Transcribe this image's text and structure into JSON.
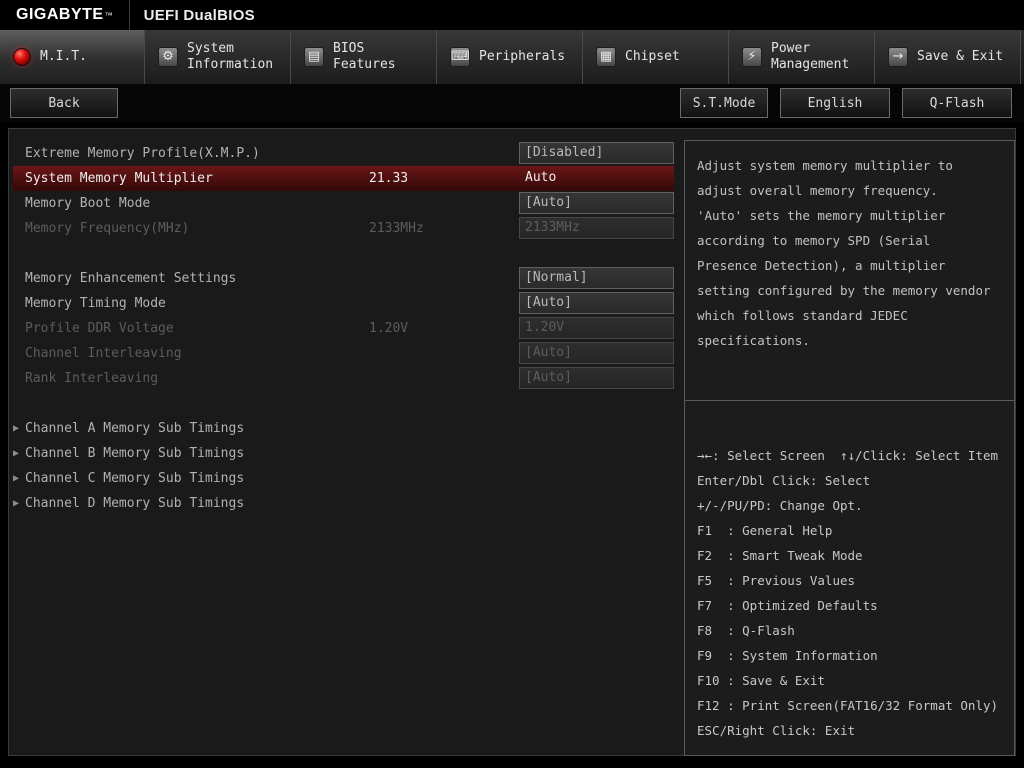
{
  "header": {
    "brand": "GIGABYTE",
    "trademark": "™",
    "title": "UEFI DualBIOS"
  },
  "colors": {
    "selected_row": "#6b1616",
    "brand_orb_red": "#e01212"
  },
  "tabs": [
    {
      "id": "mit",
      "label": "M.I.T.",
      "icon": "mit-orb-icon",
      "glyph": "",
      "active": true
    },
    {
      "id": "system-information",
      "label": "System Information",
      "icon": "gear-icon",
      "glyph": "⚙",
      "active": false
    },
    {
      "id": "bios-features",
      "label": "BIOS Features",
      "icon": "bios-icon",
      "glyph": "▤",
      "active": false
    },
    {
      "id": "peripherals",
      "label": "Peripherals",
      "icon": "peripherals-icon",
      "glyph": "⌨",
      "active": false
    },
    {
      "id": "chipset",
      "label": "Chipset",
      "icon": "chipset-icon",
      "glyph": "▦",
      "active": false
    },
    {
      "id": "power-management",
      "label": "Power Management",
      "icon": "power-icon",
      "glyph": "⚡",
      "active": false
    },
    {
      "id": "save-exit",
      "label": "Save & Exit",
      "icon": "save-exit-icon",
      "glyph": "→",
      "active": false
    }
  ],
  "toolbar": {
    "back": "Back",
    "st_mode": "S.T.Mode",
    "language": "English",
    "q_flash": "Q-Flash"
  },
  "settings": {
    "rows": [
      {
        "type": "option",
        "label": "Extreme Memory Profile(X.M.P.)",
        "current": "",
        "value": "[Disabled]",
        "state": "normal"
      },
      {
        "type": "option",
        "label": "System Memory Multiplier",
        "current": "21.33",
        "value": "Auto",
        "state": "selected"
      },
      {
        "type": "option",
        "label": "Memory Boot Mode",
        "current": "",
        "value": "[Auto]",
        "state": "normal"
      },
      {
        "type": "option",
        "label": "Memory Frequency(MHz)",
        "current": "2133MHz",
        "value": "2133MHz",
        "state": "disabled"
      },
      {
        "type": "spacer"
      },
      {
        "type": "option",
        "label": "Memory Enhancement Settings",
        "current": "",
        "value": "[Normal]",
        "state": "normal"
      },
      {
        "type": "option",
        "label": "Memory Timing Mode",
        "current": "",
        "value": "[Auto]",
        "state": "normal"
      },
      {
        "type": "option",
        "label": "Profile DDR Voltage",
        "current": "1.20V",
        "value": "1.20V",
        "state": "disabled"
      },
      {
        "type": "option",
        "label": "Channel Interleaving",
        "current": "",
        "value": "[Auto]",
        "state": "disabled"
      },
      {
        "type": "option",
        "label": "Rank Interleaving",
        "current": "",
        "value": "[Auto]",
        "state": "disabled"
      },
      {
        "type": "spacer"
      },
      {
        "type": "submenu",
        "label": "Channel A Memory Sub Timings"
      },
      {
        "type": "submenu",
        "label": "Channel B Memory Sub Timings"
      },
      {
        "type": "submenu",
        "label": "Channel C Memory Sub Timings"
      },
      {
        "type": "submenu",
        "label": "Channel D Memory Sub Timings"
      }
    ],
    "submenu_arrow": "▶"
  },
  "help": {
    "text": "Adjust system memory multiplier to\nadjust overall memory frequency.\n'Auto' sets the memory multiplier\naccording to memory SPD (Serial\nPresence Detection), a multiplier\nsetting configured by the memory vendor\nwhich follows standard JEDEC\nspecifications."
  },
  "shortcuts": [
    "→←: Select Screen  ↑↓/Click: Select Item",
    "Enter/Dbl Click: Select",
    "+/-/PU/PD: Change Opt.",
    "F1  : General Help",
    "F2  : Smart Tweak Mode",
    "F5  : Previous Values",
    "F7  : Optimized Defaults",
    "F8  : Q-Flash",
    "F9  : System Information",
    "F10 : Save & Exit",
    "F12 : Print Screen(FAT16/32 Format Only)",
    "ESC/Right Click: Exit"
  ]
}
